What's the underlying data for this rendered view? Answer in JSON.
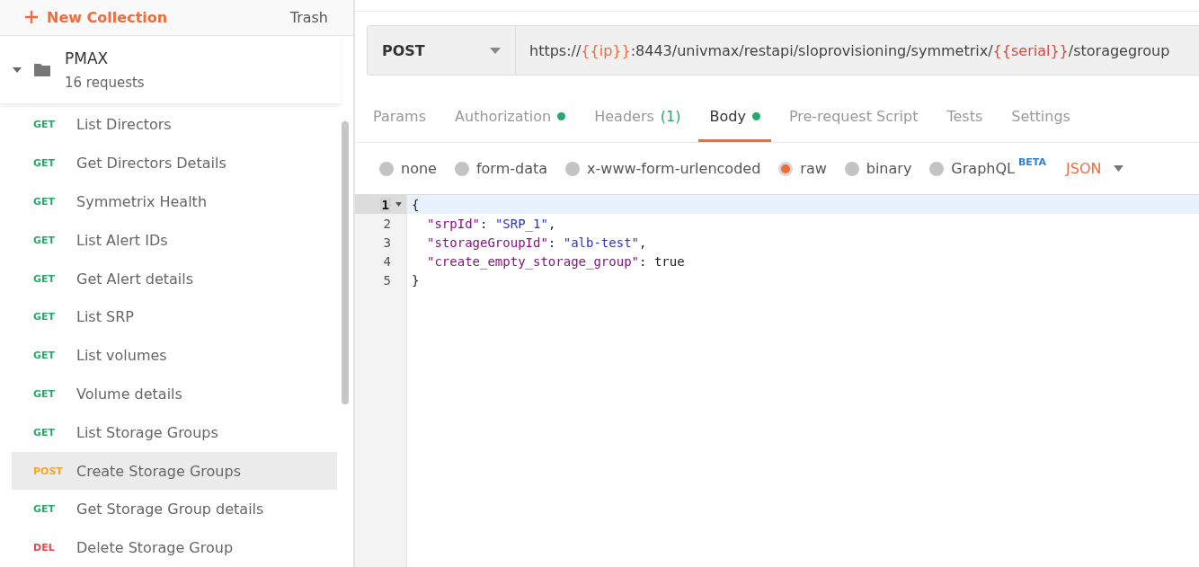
{
  "sidebar": {
    "new_collection": "New Collection",
    "trash": "Trash",
    "collection": {
      "name": "PMAX",
      "count": "16 requests",
      "expanded": true
    },
    "requests": [
      {
        "method": "GET",
        "name": "List Directors",
        "selected": false
      },
      {
        "method": "GET",
        "name": "Get Directors Details",
        "selected": false
      },
      {
        "method": "GET",
        "name": "Symmetrix Health",
        "selected": false
      },
      {
        "method": "GET",
        "name": "List Alert IDs",
        "selected": false
      },
      {
        "method": "GET",
        "name": "Get Alert details",
        "selected": false
      },
      {
        "method": "GET",
        "name": "List SRP",
        "selected": false
      },
      {
        "method": "GET",
        "name": "List volumes",
        "selected": false
      },
      {
        "method": "GET",
        "name": "Volume details",
        "selected": false
      },
      {
        "method": "GET",
        "name": "List Storage Groups",
        "selected": false
      },
      {
        "method": "POST",
        "name": "Create Storage Groups",
        "selected": true
      },
      {
        "method": "GET",
        "name": "Get Storage Group details",
        "selected": false
      },
      {
        "method": "DEL",
        "name": "Delete Storage Group",
        "selected": false
      }
    ]
  },
  "request": {
    "method": "POST",
    "url": [
      {
        "kind": "text",
        "text": "https://"
      },
      {
        "kind": "variable",
        "text": "{{ip}}",
        "color": "#f26b3a"
      },
      {
        "kind": "text",
        "text": ":8443/univmax/restapi/sloprovisioning/symmetrix/"
      },
      {
        "kind": "variable",
        "text": "{{serial}}",
        "color": "#e0453a"
      },
      {
        "kind": "text",
        "text": "/storagegroup"
      }
    ]
  },
  "tabs": [
    {
      "label": "Params",
      "selected": false
    },
    {
      "label": "Authorization",
      "selected": false,
      "dot": true
    },
    {
      "label": "Headers",
      "count": "(1)",
      "selected": false
    },
    {
      "label": "Body",
      "selected": true,
      "dot": true
    },
    {
      "label": "Pre-request Script",
      "selected": false
    },
    {
      "label": "Tests",
      "selected": false
    },
    {
      "label": "Settings",
      "selected": false
    }
  ],
  "body_types": [
    {
      "label": "none",
      "selected": false
    },
    {
      "label": "form-data",
      "selected": false
    },
    {
      "label": "x-www-form-urlencoded",
      "selected": false
    },
    {
      "label": "raw",
      "selected": true
    },
    {
      "label": "binary",
      "selected": false
    },
    {
      "label": "GraphQL",
      "badge": "BETA",
      "selected": false
    }
  ],
  "format": "JSON",
  "editor": {
    "lines": [
      {
        "number": "1",
        "active": true,
        "fold": true,
        "indent": false,
        "tokens": [
          {
            "kind": "punct",
            "text": "{"
          }
        ]
      },
      {
        "number": "2",
        "active": false,
        "indent": true,
        "tokens": [
          {
            "kind": "key",
            "text": "\"srpId\""
          },
          {
            "kind": "punct",
            "text": ": "
          },
          {
            "kind": "string",
            "text": "\"SRP_1\""
          },
          {
            "kind": "punct",
            "text": ","
          }
        ]
      },
      {
        "number": "3",
        "active": false,
        "indent": true,
        "tokens": [
          {
            "kind": "key",
            "text": "\"storageGroupId\""
          },
          {
            "kind": "punct",
            "text": ": "
          },
          {
            "kind": "string",
            "text": "\"alb-test\""
          },
          {
            "kind": "punct",
            "text": ","
          }
        ]
      },
      {
        "number": "4",
        "active": false,
        "indent": true,
        "tokens": [
          {
            "kind": "key",
            "text": "\"create_empty_storage_group\""
          },
          {
            "kind": "punct",
            "text": ": "
          },
          {
            "kind": "literal",
            "text": "true"
          }
        ]
      },
      {
        "number": "5",
        "active": false,
        "indent": false,
        "tokens": [
          {
            "kind": "punct",
            "text": "}"
          }
        ]
      }
    ]
  }
}
